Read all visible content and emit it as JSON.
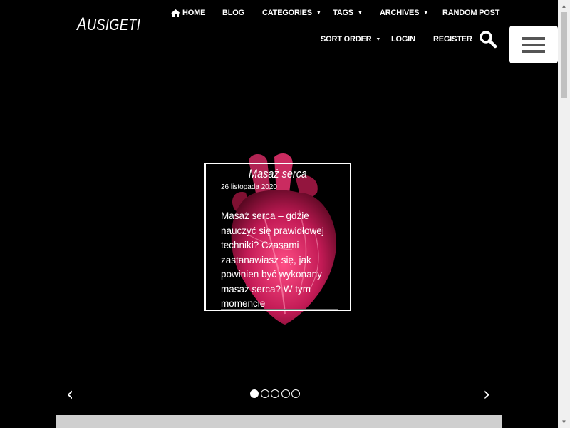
{
  "site": {
    "logo_first": "A",
    "logo_rest": "USIGETI"
  },
  "nav": {
    "home": "HOME",
    "blog": "BLOG",
    "categories": "CATEGORIES",
    "tags": "TAGS",
    "archives": "ARCHIVES",
    "random_post": "RANDOM POST",
    "sort_order": "SORT ORDER",
    "login": "LOGIN",
    "register": "REGISTER"
  },
  "slide": {
    "title": "Masaż serca",
    "date": "26 listopada 2020",
    "excerpt": "Masaż serca – gdzie nauczyć się prawidłowej techniki? Czasami zastanawiasz się, jak powinien być wykonany masaż serca? W tym momencie"
  },
  "carousel": {
    "prev_glyph": "‹",
    "next_glyph": "›",
    "active_index": 0,
    "slide_count": 5
  },
  "icons": {
    "home": "home-icon",
    "search": "search-icon",
    "menu": "hamburger-menu-icon",
    "caret": "caret-down-icon"
  },
  "colors": {
    "background": "#000000",
    "text": "#ffffff",
    "heart": "#e0306a",
    "menu_button_bg": "#ffffff",
    "menu_bars": "#555555"
  }
}
